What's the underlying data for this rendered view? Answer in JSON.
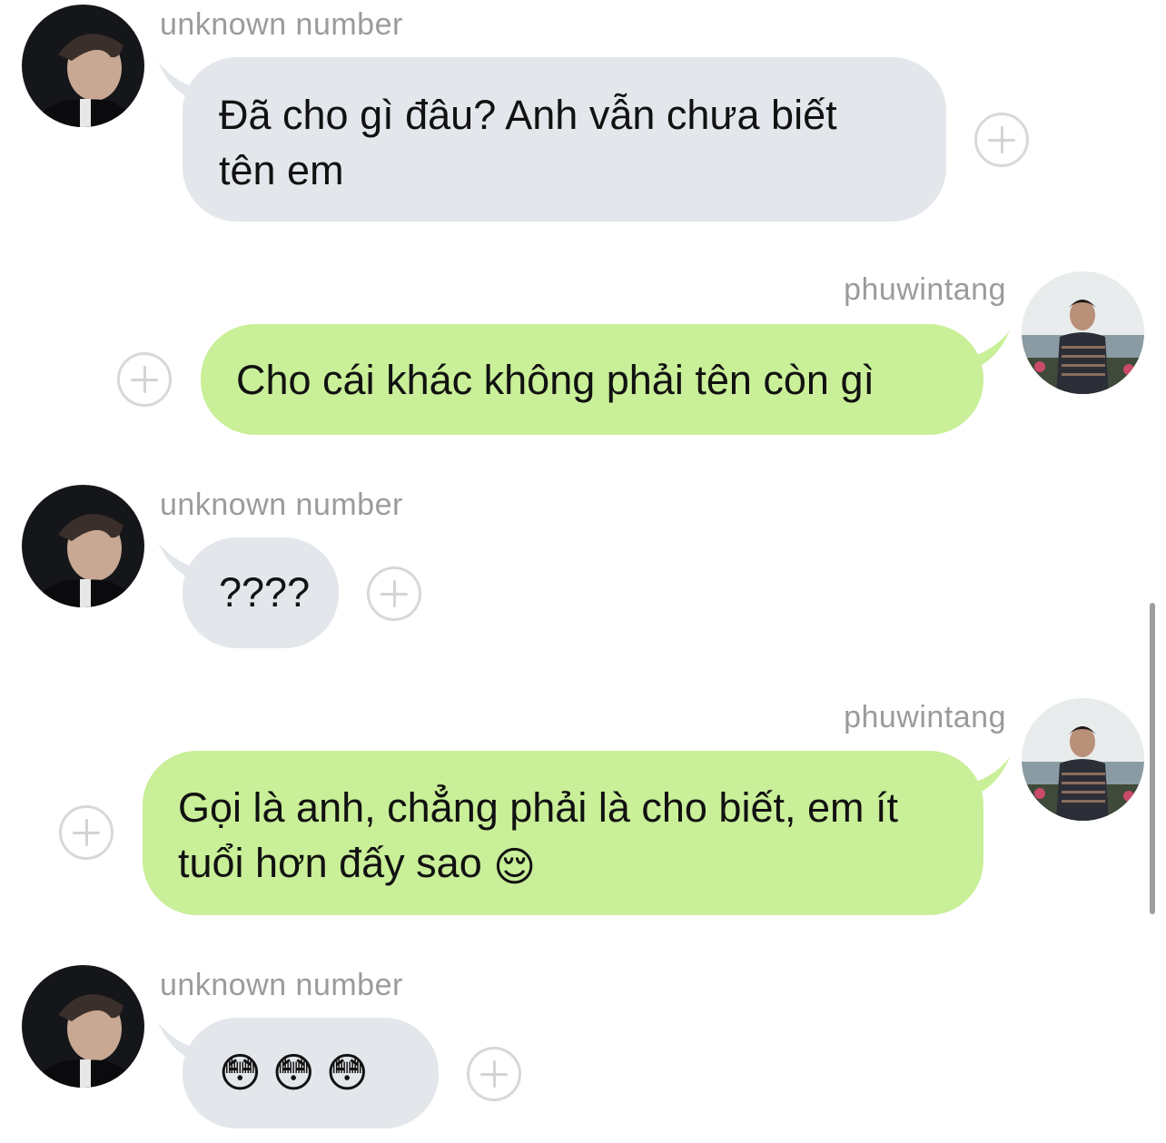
{
  "messages": [
    {
      "sender": "unknown number",
      "direction": "incoming",
      "text": "Đã cho gì đâu? Anh vẫn chưa biết tên em"
    },
    {
      "sender": "phuwintang",
      "direction": "outgoing",
      "text": "Cho cái khác không phải tên còn gì"
    },
    {
      "sender": "unknown number",
      "direction": "incoming",
      "text": "????"
    },
    {
      "sender": "phuwintang",
      "direction": "outgoing",
      "text": "Gọi là anh, chẳng phải là cho biết, em ít tuổi hơn đấy sao",
      "emoji": "😌"
    },
    {
      "sender": "unknown number",
      "direction": "incoming",
      "text": "",
      "emoji": [
        "😳",
        "😳",
        "😳"
      ]
    }
  ],
  "icons": {
    "add_reaction": "add-reaction-icon",
    "avatar_unknown": "avatar-unknown-number",
    "avatar_phuwintang": "avatar-phuwintang"
  },
  "colors": {
    "incoming_bubble": "#e3e6ea",
    "outgoing_bubble": "#c9ef98",
    "sender_name": "#9b9b9b"
  }
}
